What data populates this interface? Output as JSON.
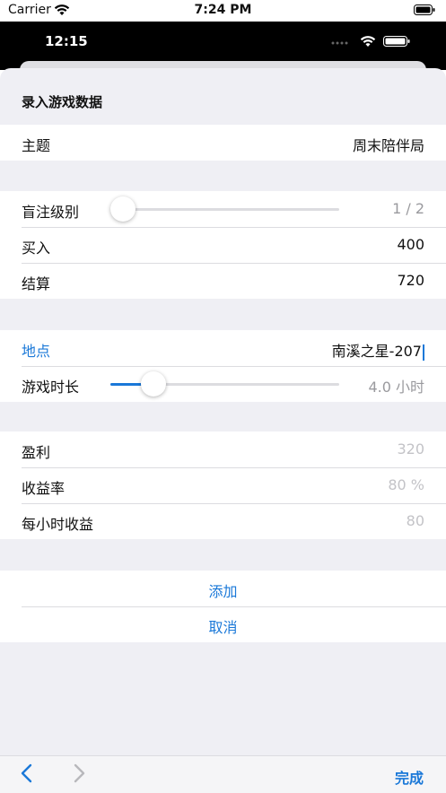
{
  "status_bar": {
    "carrier": "Carrier",
    "time": "7:24 PM"
  },
  "inner_status": {
    "time": "12:15"
  },
  "sheet": {
    "title": "录入游戏数据"
  },
  "theme": {
    "label": "主题",
    "value": "周末陪伴局"
  },
  "blinds": {
    "label": "盲注级别",
    "value": "1 / 2",
    "slider_fraction": 0.0
  },
  "buyin": {
    "label": "买入",
    "value": "400"
  },
  "settle": {
    "label": "结算",
    "value": "720"
  },
  "location": {
    "label": "地点",
    "value": "南溪之星-207"
  },
  "duration": {
    "label": "游戏时长",
    "value": "4.0 小时",
    "slider_fraction": 0.19
  },
  "profit": {
    "label": "盈利",
    "value": "320"
  },
  "roi": {
    "label": "收益率",
    "value": "80 %"
  },
  "hourly": {
    "label": "每小时收益",
    "value": "80"
  },
  "actions": {
    "add": "添加",
    "cancel": "取消"
  },
  "toolbar": {
    "done": "完成"
  },
  "colors": {
    "accent": "#1a78d8",
    "sheet_bg": "#efeff4"
  },
  "icons": [
    "wifi-icon",
    "battery-icon",
    "signal-dots-icon",
    "chevron-left-icon",
    "chevron-right-icon"
  ]
}
